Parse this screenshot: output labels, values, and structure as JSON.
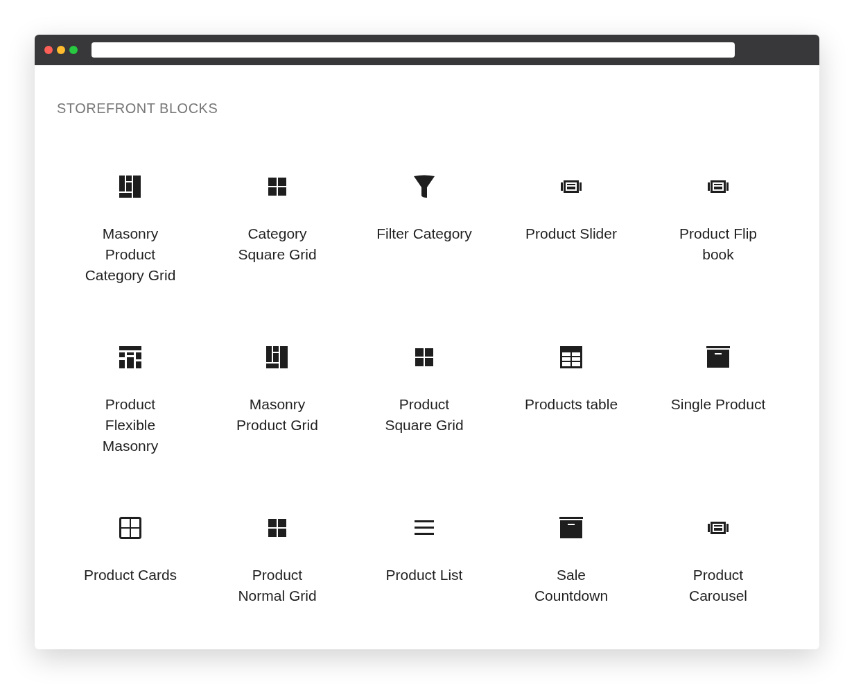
{
  "heading": "STOREFRONT BLOCKS",
  "blocks": [
    {
      "kind": "masonry",
      "lines": [
        "Masonry",
        "Product",
        "Category Grid"
      ]
    },
    {
      "kind": "grid",
      "lines": [
        "Category",
        "Square Grid"
      ]
    },
    {
      "kind": "funnel",
      "lines": [
        "Filter Category"
      ]
    },
    {
      "kind": "slider",
      "lines": [
        "Product Slider"
      ]
    },
    {
      "kind": "slider",
      "lines": [
        "Product Flip",
        "book"
      ]
    },
    {
      "kind": "flexible",
      "lines": [
        "Product",
        "Flexible",
        "Masonry"
      ]
    },
    {
      "kind": "masonry",
      "lines": [
        "Masonry",
        "Product Grid"
      ]
    },
    {
      "kind": "grid",
      "lines": [
        "Product",
        "Square Grid"
      ]
    },
    {
      "kind": "table",
      "lines": [
        "Products table"
      ]
    },
    {
      "kind": "archive",
      "lines": [
        "Single Product"
      ]
    },
    {
      "kind": "cards",
      "lines": [
        "Product Cards"
      ]
    },
    {
      "kind": "grid",
      "lines": [
        "Product",
        "Normal Grid"
      ]
    },
    {
      "kind": "list",
      "lines": [
        "Product List"
      ]
    },
    {
      "kind": "archive",
      "lines": [
        "Sale",
        "Countdown"
      ]
    },
    {
      "kind": "slider",
      "lines": [
        "Product",
        "Carousel"
      ]
    }
  ]
}
